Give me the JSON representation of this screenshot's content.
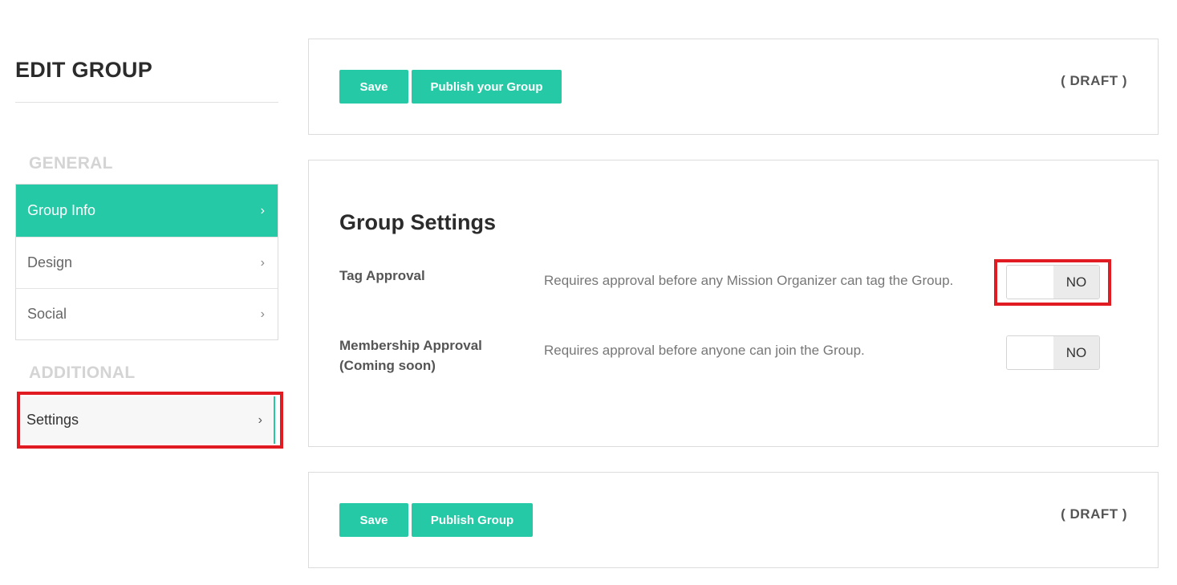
{
  "sidebar": {
    "title": "EDIT GROUP",
    "general_label": "GENERAL",
    "additional_label": "ADDITIONAL",
    "general_items": [
      {
        "label": "Group Info",
        "active": true
      },
      {
        "label": "Design",
        "active": false
      },
      {
        "label": "Social",
        "active": false
      }
    ],
    "additional_items": [
      {
        "label": "Settings",
        "active": false
      }
    ],
    "chevron": "›"
  },
  "top_bar": {
    "save_label": "Save",
    "publish_label": "Publish your Group",
    "status": "( DRAFT )"
  },
  "settings": {
    "title": "Group Settings",
    "rows": [
      {
        "label": "Tag Approval",
        "description": "Requires approval before any Mission Organizer can tag the Group.",
        "toggle_value": "NO"
      },
      {
        "label_line1": "Membership Approval",
        "label_line2": "(Coming soon)",
        "description": "Requires approval before anyone can join the Group.",
        "toggle_value": "NO"
      }
    ]
  },
  "bottom_bar": {
    "save_label": "Save",
    "publish_label": "Publish Group",
    "status": "( DRAFT )"
  },
  "colors": {
    "accent": "#26c9a6",
    "highlight": "#e11b22",
    "section_label": "#d4d4d4"
  },
  "icons": [
    "chevron-right-icon"
  ]
}
